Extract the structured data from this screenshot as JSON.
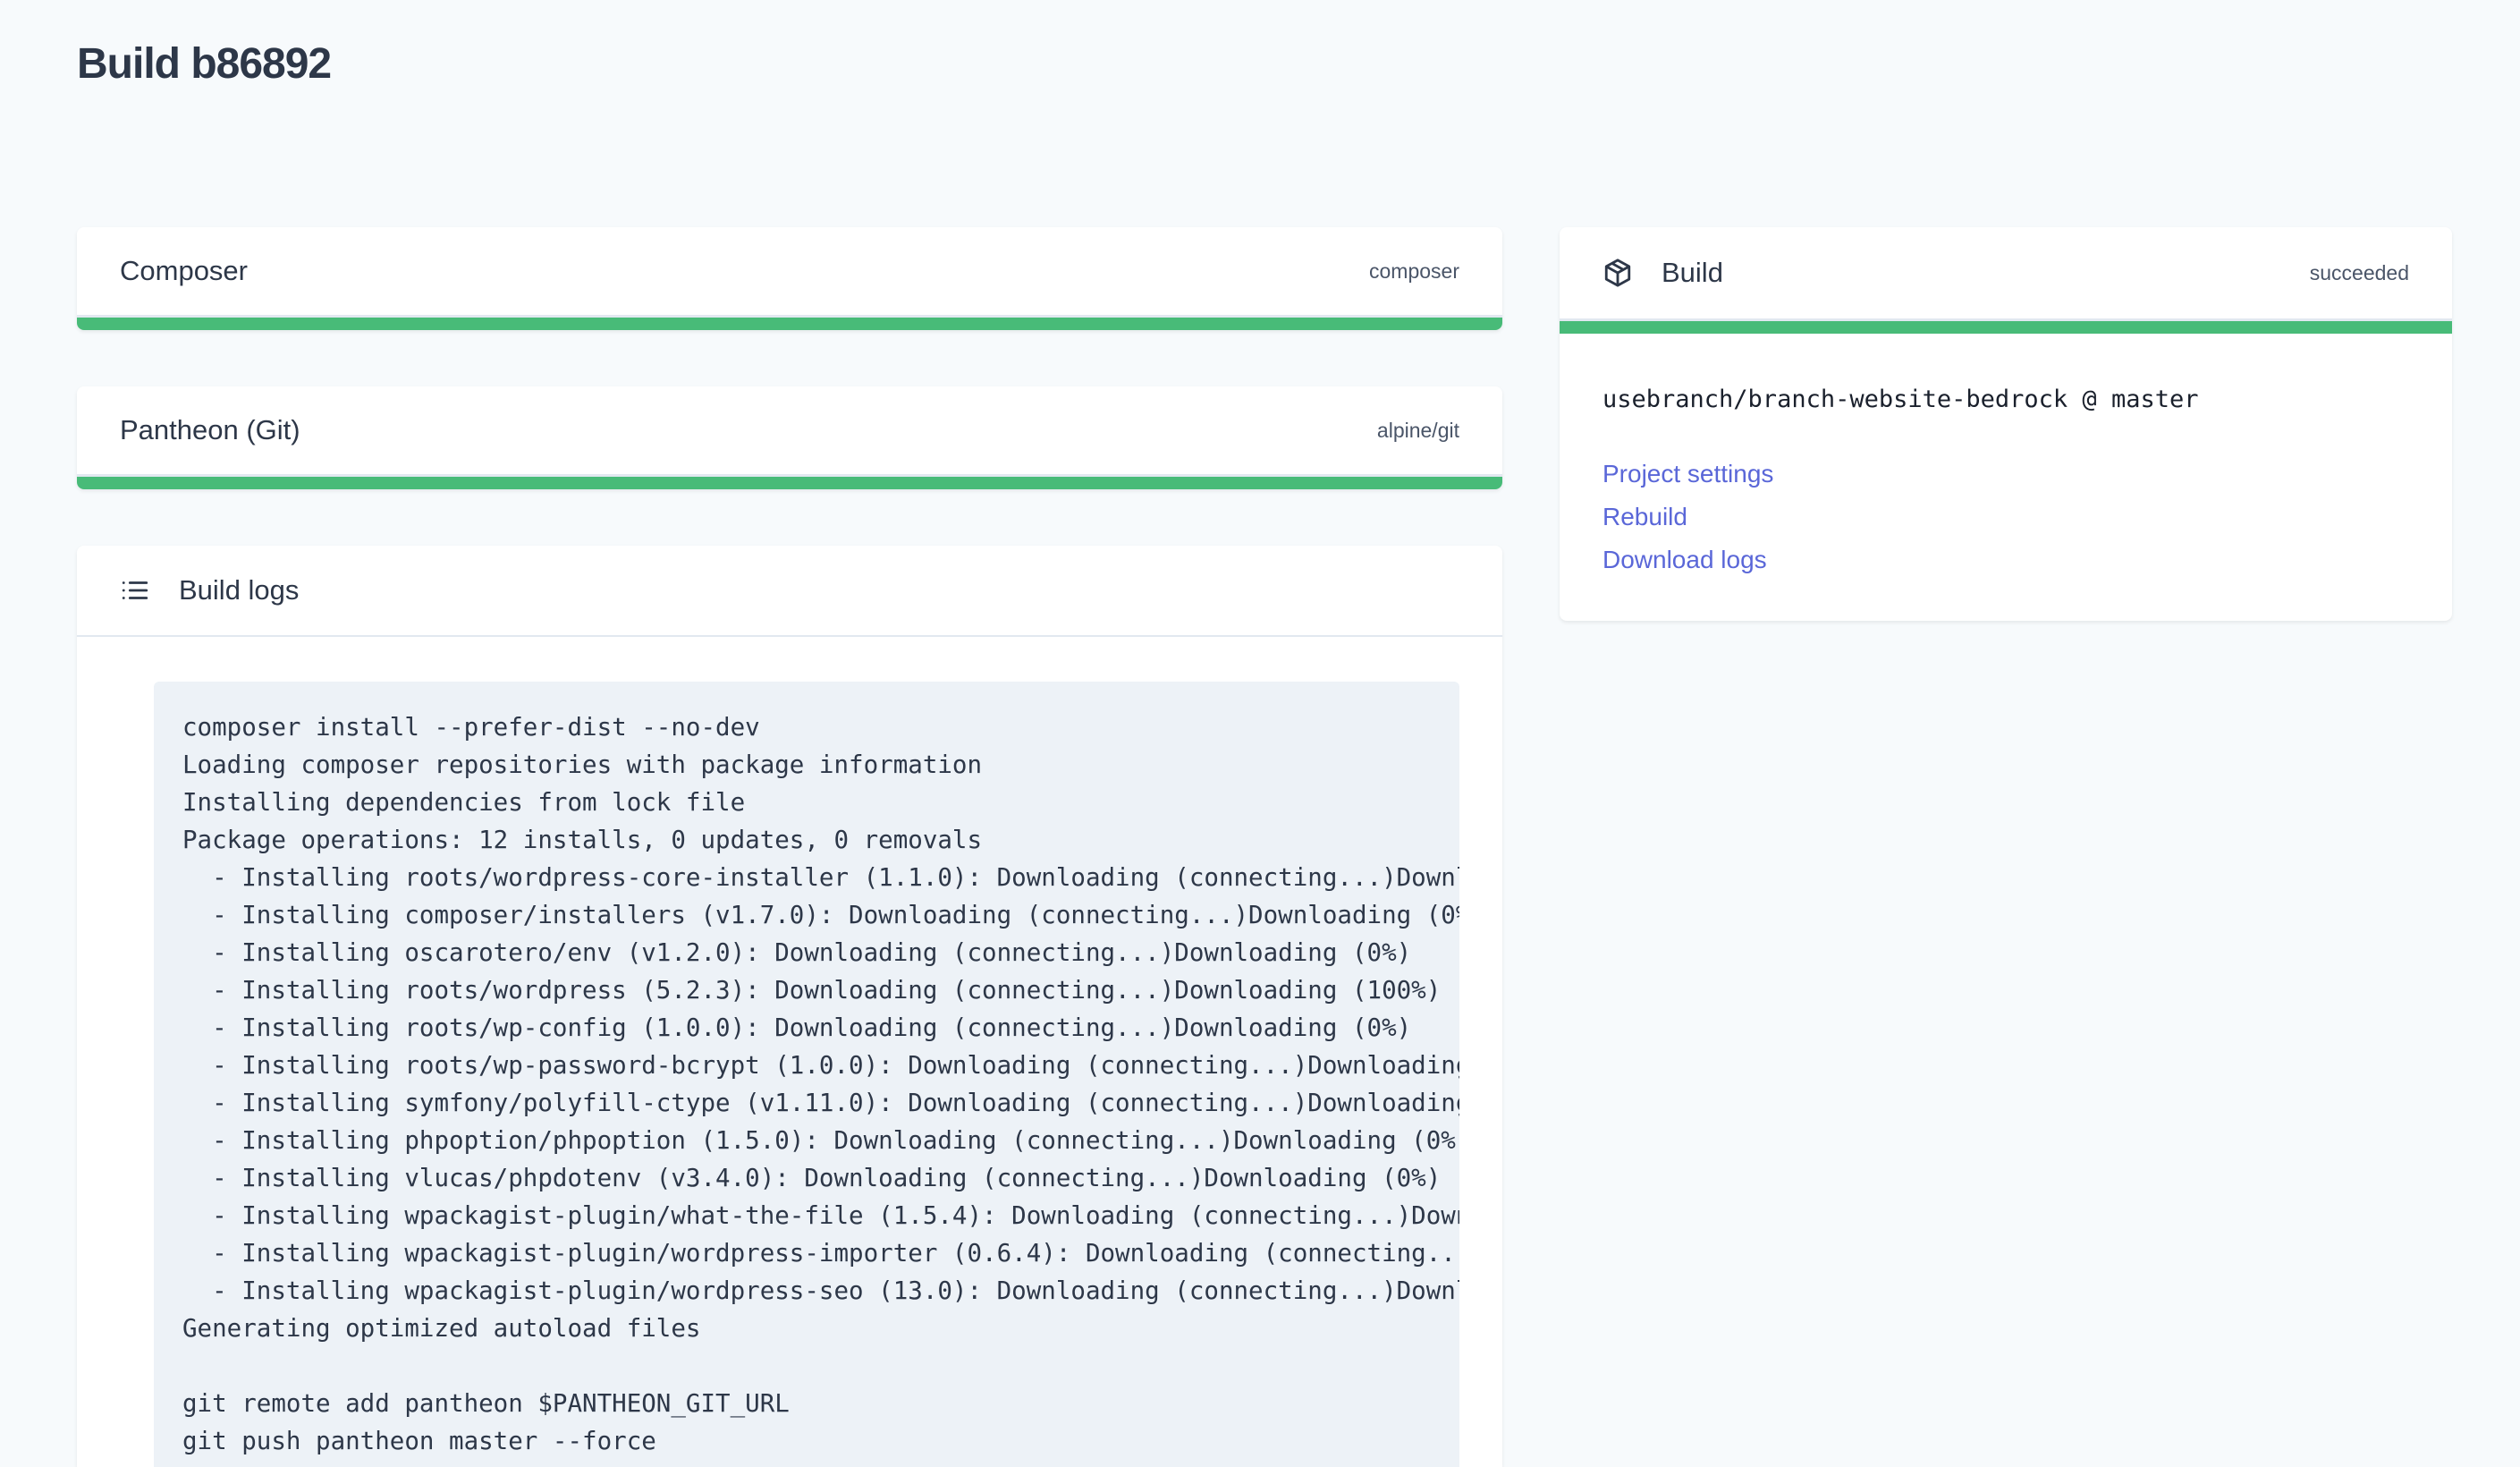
{
  "page": {
    "title": "Build b86892"
  },
  "colors": {
    "success": "#48bb78",
    "link": "#5a67d8",
    "text": "#2d3748",
    "background": "#f7fafc"
  },
  "steps": [
    {
      "name": "Composer",
      "image": "composer",
      "status_color": "#48bb78"
    },
    {
      "name": "Pantheon (Git)",
      "image": "alpine/git",
      "status_color": "#48bb78"
    }
  ],
  "logs": {
    "title": "Build logs",
    "icon": "list-icon",
    "content": "composer install --prefer-dist --no-dev\nLoading composer repositories with package information\nInstalling dependencies from lock file\nPackage operations: 12 installs, 0 updates, 0 removals\n  - Installing roots/wordpress-core-installer (1.1.0): Downloading (connecting...)Downl\n  - Installing composer/installers (v1.7.0): Downloading (connecting...)Downloading (0%\n  - Installing oscarotero/env (v1.2.0): Downloading (connecting...)Downloading (0%)\n  - Installing roots/wordpress (5.2.3): Downloading (connecting...)Downloading (100%)\n  - Installing roots/wp-config (1.0.0): Downloading (connecting...)Downloading (0%)\n  - Installing roots/wp-password-bcrypt (1.0.0): Downloading (connecting...)Downloading\n  - Installing symfony/polyfill-ctype (v1.11.0): Downloading (connecting...)Downloading\n  - Installing phpoption/phpoption (1.5.0): Downloading (connecting...)Downloading (0%)\n  - Installing vlucas/phpdotenv (v3.4.0): Downloading (connecting...)Downloading (0%)\n  - Installing wpackagist-plugin/what-the-file (1.5.4): Downloading (connecting...)Down\n  - Installing wpackagist-plugin/wordpress-importer (0.6.4): Downloading (connecting...\n  - Installing wpackagist-plugin/wordpress-seo (13.0): Downloading (connecting...)Downl\nGenerating optimized autoload files\n\ngit remote add pantheon $PANTHEON_GIT_URL\ngit push pantheon master --force"
  },
  "build": {
    "title": "Build",
    "icon": "package-icon",
    "status": "succeeded",
    "repo": "usebranch/branch-website-bedrock @ master",
    "links": [
      "Project settings",
      "Rebuild",
      "Download logs"
    ]
  }
}
